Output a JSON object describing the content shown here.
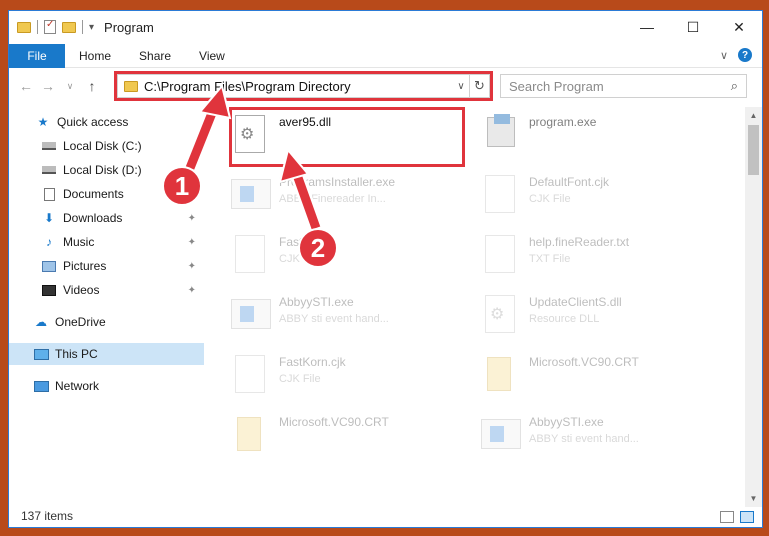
{
  "window": {
    "title": "Program",
    "controls": {
      "minimize": "—",
      "maximize": "☐",
      "close": "✕"
    }
  },
  "ribbon": {
    "tabs": [
      "File",
      "Home",
      "Share",
      "View"
    ],
    "collapse_icon": "∨",
    "help": "?"
  },
  "navigation": {
    "back": "←",
    "forward": "→",
    "recent": "∨",
    "up": "↑",
    "address": "C:\\Program Files\\Program Directory",
    "dropdown": "∨",
    "refresh": "↻",
    "search_placeholder": "Search Program",
    "search_icon": "⌕"
  },
  "sidebar": {
    "items": [
      {
        "label": "Quick access",
        "icon": "star-icon"
      },
      {
        "label": "Local Disk (C:)",
        "icon": "drive-icon"
      },
      {
        "label": "Local Disk (D:)",
        "icon": "drive-icon"
      },
      {
        "label": "Documents",
        "icon": "documents-icon"
      },
      {
        "label": "Downloads",
        "icon": "download-icon",
        "pinned": true
      },
      {
        "label": "Music",
        "icon": "music-icon",
        "pinned": true
      },
      {
        "label": "Pictures",
        "icon": "pictures-icon",
        "pinned": true
      },
      {
        "label": "Videos",
        "icon": "videos-icon",
        "pinned": true
      },
      {
        "label": "OneDrive",
        "icon": "cloud-icon"
      },
      {
        "label": "This PC",
        "icon": "computer-icon",
        "selected": true
      },
      {
        "label": "Network",
        "icon": "network-icon"
      }
    ],
    "pin_glyph": "📌"
  },
  "files": [
    {
      "name": "aver95.dll",
      "sub": "",
      "type": "dll"
    },
    {
      "name": "program.exe",
      "sub": "",
      "type": "installer"
    },
    {
      "name": "ProgramsInstaller.exe",
      "sub": "ABBY Finereader In...",
      "type": "app"
    },
    {
      "name": "DefaultFont.cjk",
      "sub": "CJK File",
      "type": "doc"
    },
    {
      "name": "FastBlock",
      "sub": "CJK",
      "type": "doc"
    },
    {
      "name": "help.fineReader.txt",
      "sub": "TXT File",
      "type": "doc"
    },
    {
      "name": "AbbyySTI.exe",
      "sub": "ABBY sti event hand...",
      "type": "app"
    },
    {
      "name": "UpdateClientS.dll",
      "sub": "Resource DLL",
      "type": "dll"
    },
    {
      "name": "FastKorn.cjk",
      "sub": "CJK File",
      "type": "doc"
    },
    {
      "name": "Microsoft.VC90.CRT",
      "sub": "",
      "type": "folder"
    },
    {
      "name": "Microsoft.VC90.CRT",
      "sub": "",
      "type": "folder"
    },
    {
      "name": "AbbyySTI.exe",
      "sub": "ABBY sti event hand...",
      "type": "app"
    }
  ],
  "status": {
    "items": "137 items"
  },
  "callouts": [
    "1",
    "2"
  ],
  "colors": {
    "accent": "#1979ca",
    "highlight": "#e0343c",
    "selected_bg": "#cce4f7"
  }
}
